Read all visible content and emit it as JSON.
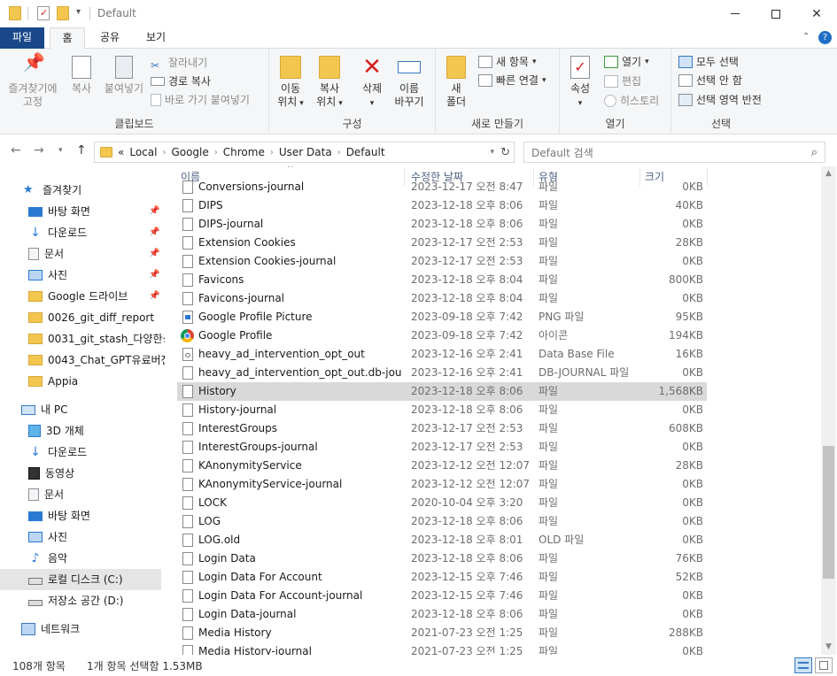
{
  "window": {
    "title": "Default"
  },
  "ribbon_tabs": [
    "파일",
    "홈",
    "공유",
    "보기"
  ],
  "ribbon": {
    "clipboard": {
      "label": "클립보드",
      "pin": [
        "즐겨찾기에",
        "고정"
      ],
      "copy": "복사",
      "paste": "붙여넣기",
      "cut": "잘라내기",
      "copy_path": "경로 복사",
      "paste_shortcut": "바로 가기 붙여넣기"
    },
    "organize": {
      "label": "구성",
      "move_to": [
        "이동",
        "위치"
      ],
      "copy_to": [
        "복사",
        "위치"
      ],
      "delete": "삭제",
      "rename": [
        "이름",
        "바꾸기"
      ]
    },
    "new": {
      "label": "새로 만들기",
      "new_folder": [
        "새",
        "폴더"
      ],
      "new_item": "새 항목",
      "easy_access": "빠른 연결"
    },
    "open": {
      "label": "열기",
      "properties": "속성",
      "open": "열기",
      "edit": "편집",
      "history": "히스토리"
    },
    "select": {
      "label": "선택",
      "select_all": "모두 선택",
      "select_none": "선택 안 함",
      "invert": "선택 영역 반전"
    }
  },
  "address": {
    "prefix": "«",
    "crumbs": [
      "Local",
      "Google",
      "Chrome",
      "User Data",
      "Default"
    ],
    "search_placeholder": "Default 검색"
  },
  "nav": {
    "quick_access": "즐겨찾기",
    "quick_items": [
      "바탕 화면",
      "다운로드",
      "문서",
      "사진",
      "Google 드라이브",
      "0026_git_diff_report",
      "0031_git_stash_다양한상",
      "0043_Chat_GPT유료버전",
      "Appia"
    ],
    "this_pc": "내 PC",
    "pc_items": [
      "3D 개체",
      "다운로드",
      "동영상",
      "문서",
      "바탕 화면",
      "사진",
      "음악",
      "로컬 디스크 (C:)",
      "저장소 공간 (D:)"
    ],
    "network": "네트워크"
  },
  "columns": [
    "이름",
    "수정한 날짜",
    "유형",
    "크기"
  ],
  "files": [
    {
      "name": "Conversions-journal",
      "date": "2023-12-17 오전 8:47",
      "type": "파일",
      "size": "0KB",
      "icon": "file"
    },
    {
      "name": "DIPS",
      "date": "2023-12-18 오후 8:06",
      "type": "파일",
      "size": "40KB",
      "icon": "file"
    },
    {
      "name": "DIPS-journal",
      "date": "2023-12-18 오후 8:06",
      "type": "파일",
      "size": "0KB",
      "icon": "file"
    },
    {
      "name": "Extension Cookies",
      "date": "2023-12-17 오전 2:53",
      "type": "파일",
      "size": "28KB",
      "icon": "file"
    },
    {
      "name": "Extension Cookies-journal",
      "date": "2023-12-17 오전 2:53",
      "type": "파일",
      "size": "0KB",
      "icon": "file"
    },
    {
      "name": "Favicons",
      "date": "2023-12-18 오후 8:04",
      "type": "파일",
      "size": "800KB",
      "icon": "file"
    },
    {
      "name": "Favicons-journal",
      "date": "2023-12-18 오후 8:04",
      "type": "파일",
      "size": "0KB",
      "icon": "file"
    },
    {
      "name": "Google Profile Picture",
      "date": "2023-09-18 오후 7:42",
      "type": "PNG 파일",
      "size": "95KB",
      "icon": "png"
    },
    {
      "name": "Google Profile",
      "date": "2023-09-18 오후 7:42",
      "type": "아이콘",
      "size": "194KB",
      "icon": "chrome"
    },
    {
      "name": "heavy_ad_intervention_opt_out",
      "date": "2023-12-16 오후 2:41",
      "type": "Data Base File",
      "size": "16KB",
      "icon": "db"
    },
    {
      "name": "heavy_ad_intervention_opt_out.db-journal",
      "date": "2023-12-16 오후 2:41",
      "type": "DB-JOURNAL 파일",
      "size": "0KB",
      "icon": "file"
    },
    {
      "name": "History",
      "date": "2023-12-18 오후 8:06",
      "type": "파일",
      "size": "1,568KB",
      "icon": "file",
      "selected": true
    },
    {
      "name": "History-journal",
      "date": "2023-12-18 오후 8:06",
      "type": "파일",
      "size": "0KB",
      "icon": "file"
    },
    {
      "name": "InterestGroups",
      "date": "2023-12-17 오전 2:53",
      "type": "파일",
      "size": "608KB",
      "icon": "file"
    },
    {
      "name": "InterestGroups-journal",
      "date": "2023-12-17 오전 2:53",
      "type": "파일",
      "size": "0KB",
      "icon": "file"
    },
    {
      "name": "KAnonymityService",
      "date": "2023-12-12 오전 12:07",
      "type": "파일",
      "size": "28KB",
      "icon": "file"
    },
    {
      "name": "KAnonymityService-journal",
      "date": "2023-12-12 오전 12:07",
      "type": "파일",
      "size": "0KB",
      "icon": "file"
    },
    {
      "name": "LOCK",
      "date": "2020-10-04 오후 3:20",
      "type": "파일",
      "size": "0KB",
      "icon": "file"
    },
    {
      "name": "LOG",
      "date": "2023-12-18 오후 8:06",
      "type": "파일",
      "size": "0KB",
      "icon": "file"
    },
    {
      "name": "LOG.old",
      "date": "2023-12-18 오후 8:01",
      "type": "OLD 파일",
      "size": "0KB",
      "icon": "file"
    },
    {
      "name": "Login Data",
      "date": "2023-12-18 오후 8:06",
      "type": "파일",
      "size": "76KB",
      "icon": "file"
    },
    {
      "name": "Login Data For Account",
      "date": "2023-12-15 오후 7:46",
      "type": "파일",
      "size": "52KB",
      "icon": "file"
    },
    {
      "name": "Login Data For Account-journal",
      "date": "2023-12-15 오후 7:46",
      "type": "파일",
      "size": "0KB",
      "icon": "file"
    },
    {
      "name": "Login Data-journal",
      "date": "2023-12-18 오후 8:06",
      "type": "파일",
      "size": "0KB",
      "icon": "file"
    },
    {
      "name": "Media History",
      "date": "2021-07-23 오전 1:25",
      "type": "파일",
      "size": "288KB",
      "icon": "file"
    },
    {
      "name": "Media History-journal",
      "date": "2021-07-23 오전 1:25",
      "type": "파일",
      "size": "0KB",
      "icon": "file"
    }
  ],
  "status": {
    "item_count": "108개 항목",
    "selection": "1개 항목 선택함 1.53MB"
  },
  "colors": {
    "file_tab": "#19478a",
    "folder": "#f3c74f",
    "header_text": "#4d6082",
    "selection": "#d9d9d9",
    "delete_red": "#d32020"
  }
}
